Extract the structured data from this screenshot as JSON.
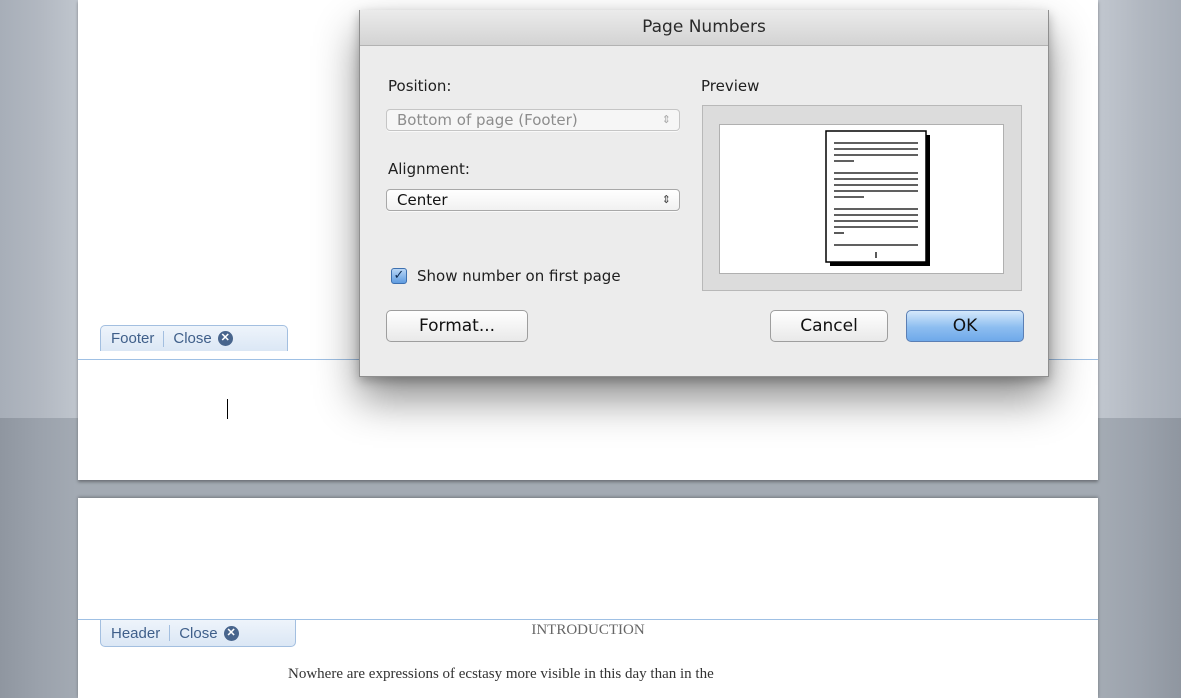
{
  "dialog": {
    "title": "Page Numbers",
    "position_label": "Position:",
    "position_value": "Bottom of page (Footer)",
    "alignment_label": "Alignment:",
    "alignment_value": "Center",
    "show_first_page_label": "Show number on first page",
    "show_first_page_checked": true,
    "preview_label": "Preview",
    "format_button": "Format...",
    "cancel_button": "Cancel",
    "ok_button": "OK"
  },
  "document": {
    "footer_tab": {
      "label": "Footer",
      "close_label": "Close"
    },
    "header_tab": {
      "label": "Header",
      "close_label": "Close"
    },
    "heading": "INTRODUCTION",
    "first_line": "Nowhere are expressions of ecstasy more visible in this day than in the"
  },
  "icons": {
    "close": "close-circle-icon",
    "checkbox": "checkmark-icon",
    "popup_arrows": "up-down-arrows-icon"
  },
  "colors": {
    "ok_button": "#7fb5ee",
    "tab_border": "#a3bfe0",
    "tab_text": "#3f5f8a",
    "header_footer_line": "#9fc0e4"
  }
}
